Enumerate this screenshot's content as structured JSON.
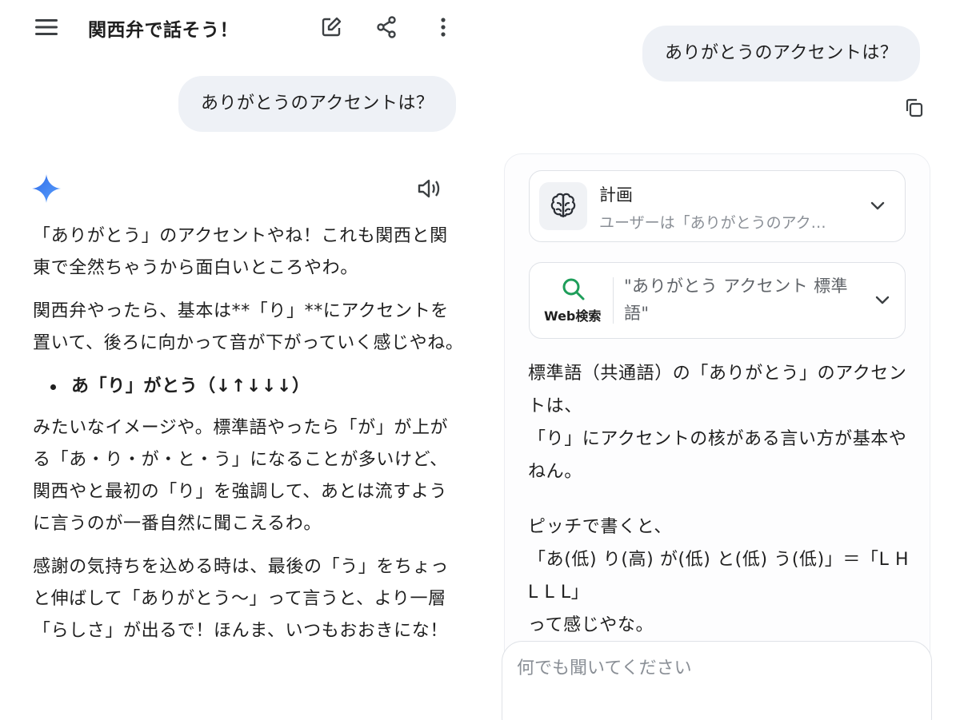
{
  "left": {
    "header": {
      "title": "関西弁で話そう！",
      "icons": [
        "menu-icon",
        "edit-icon",
        "share-icon",
        "more-vert-icon"
      ]
    },
    "user_message": "ありがとうのアクセントは？",
    "answer": {
      "p1": "「ありがとう」のアクセントやね！これも関西と関東で全然ちゃうから面白いところやわ。",
      "p2": "関西弁やったら、基本は**「り」**にアクセントを置いて、後ろに向かって音が下がっていく感じやね。",
      "bullet": "あ「り」がとう（↓↑↓↓↓）",
      "p3": "みたいなイメージや。標準語やったら「が」が上がる「あ・り・が・と・う」になることが多いけど、関西やと最初の「り」を強調して、あとは流すように言うのが一番自然に聞こえるわ。",
      "p4": "感謝の気持ちを込める時は、最後の「う」をちょっと伸ばして「ありがとう〜」って言うと、より一層「らしさ」が出るで！ほんま、いつもおおきにな！"
    }
  },
  "right": {
    "user_message": "ありがとうのアクセントは？",
    "plan": {
      "title": "計画",
      "subtitle": "ユーザーは「ありがとうのアク…"
    },
    "web_search": {
      "label": "Web検索",
      "query": "\"ありがとう アクセント 標準語\""
    },
    "answer": {
      "line1": "標準語（共通語）の「ありがとう」のアクセントは、",
      "line2": "「り」にアクセントの核がある言い方が基本やねん。",
      "line3": "ピッチで書くと、",
      "line4": "「あ(低) り(高) が(低) と(低) う(低)」＝「L H L L L」",
      "line5": "って感じやな。"
    },
    "input": {
      "placeholder": "何でも聞いてください"
    }
  },
  "colors": {
    "bubble_bg": "#eef1f6",
    "sparkle_blue": "#4a8cf7",
    "search_green": "#1e9e5a",
    "border": "#dfe2e7"
  }
}
